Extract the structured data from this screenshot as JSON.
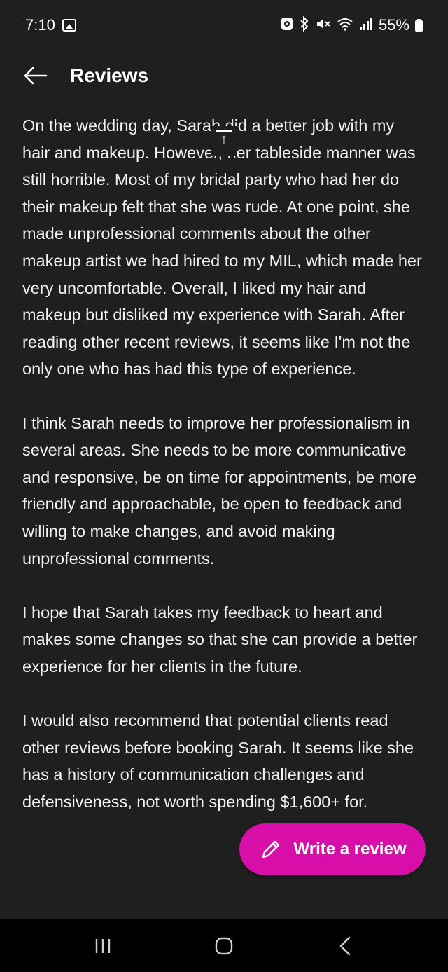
{
  "status_bar": {
    "time": "7:10",
    "battery": "55%",
    "icons": [
      "image-icon",
      "data-saver-icon",
      "bluetooth-icon",
      "mute-icon",
      "wifi-icon",
      "signal-icon",
      "battery-icon"
    ]
  },
  "header": {
    "title": "Reviews",
    "back_icon": "arrow-left-icon"
  },
  "review": {
    "paragraphs": [
      "On the wedding day, Sarah did a better job with my hair and makeup. However, her tableside manner was still horrible. Most of my bridal party who had her do their makeup felt that she was rude. At one point, she made unprofessional comments about the other makeup artist we had hired to my MIL, which made her very uncomfortable. Overall, I liked my hair and makeup but disliked my experience with Sarah. After reading other recent reviews, it seems like I'm not the only one who has had this type of experience.",
      "I think Sarah needs to improve her professionalism in several areas. She needs to be more communicative and responsive, be on time for appointments, be more friendly and approachable, be open to feedback and willing to make changes, and avoid making unprofessional comments.",
      "I hope that Sarah takes my feedback to heart and makes some changes so that she can provide a better experience for her clients in the future.",
      "I would also recommend that potential clients read other reviews before booking Sarah. It seems like she has a history of communication challenges and defensiveness, not worth spending $1,600+ for."
    ]
  },
  "actions": {
    "write_review_label": "Write a review",
    "write_review_icon": "pencil-icon",
    "scroll_top_icon": "arrow-up-icon"
  },
  "colors": {
    "background": "#1f1f1f",
    "text": "#f2f2f2",
    "accent": "#d70fa8",
    "nav_bar": "#000000"
  }
}
